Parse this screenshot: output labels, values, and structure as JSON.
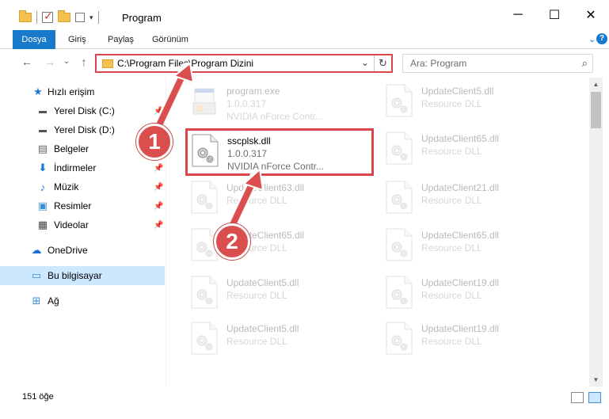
{
  "window": {
    "title": "Program",
    "minimize": "─",
    "maximize": "☐",
    "close": "✕"
  },
  "ribbon": {
    "tabs": [
      "Dosya",
      "Giriş",
      "Paylaş",
      "Görünüm"
    ],
    "help": "?"
  },
  "nav": {
    "back": "←",
    "forward": "→",
    "recent": "⌄",
    "up": "↑",
    "address": "C:\\Program Files\\Program Dizini",
    "search_placeholder": "Ara: Program"
  },
  "sidebar": {
    "items": [
      {
        "label": "Hızlı erişim",
        "icon": "star-icon"
      },
      {
        "label": "Yerel Disk (C:)",
        "icon": "drive-icon"
      },
      {
        "label": "Yerel Disk (D:)",
        "icon": "drive-icon"
      },
      {
        "label": "Belgeler",
        "icon": "documents-icon"
      },
      {
        "label": "İndirmeler",
        "icon": "download-icon"
      },
      {
        "label": "Müzik",
        "icon": "music-icon"
      },
      {
        "label": "Resimler",
        "icon": "pictures-icon"
      },
      {
        "label": "Videolar",
        "icon": "videos-icon"
      },
      {
        "label": "OneDrive",
        "icon": "cloud-icon"
      },
      {
        "label": "Bu bilgisayar",
        "icon": "computer-icon"
      },
      {
        "label": "Ağ",
        "icon": "network-icon"
      }
    ]
  },
  "files": [
    {
      "name": "program.exe",
      "line2": "1.0.0.317",
      "line3": "NVIDIA nForce Contr..."
    },
    {
      "name": "UpdateClient5.dll",
      "line2": "Resource DLL"
    },
    {
      "name": "sscplsk.dll",
      "line2": "1.0.0.317",
      "line3": "NVIDIA nForce Contr..."
    },
    {
      "name": "UpdateClient65.dll",
      "line2": "Resource DLL"
    },
    {
      "name": "UpdateClient63.dll",
      "line2": "Resource DLL"
    },
    {
      "name": "UpdateClient21.dll",
      "line2": "Resource DLL"
    },
    {
      "name": "UpdateClient65.dll",
      "line2": "Resource DLL"
    },
    {
      "name": "UpdateClient65.dll",
      "line2": "Resource DLL"
    },
    {
      "name": "UpdateClient5.dll",
      "line2": "Resource DLL"
    },
    {
      "name": "UpdateClient19.dll",
      "line2": "Resource DLL"
    },
    {
      "name": "UpdateClient5.dll",
      "line2": "Resource DLL"
    },
    {
      "name": "UpdateClient19.dll",
      "line2": "Resource DLL"
    }
  ],
  "status": {
    "count": "151 öğe"
  },
  "annotations": {
    "step1": "1",
    "step2": "2",
    "color": "#da4e4e"
  }
}
